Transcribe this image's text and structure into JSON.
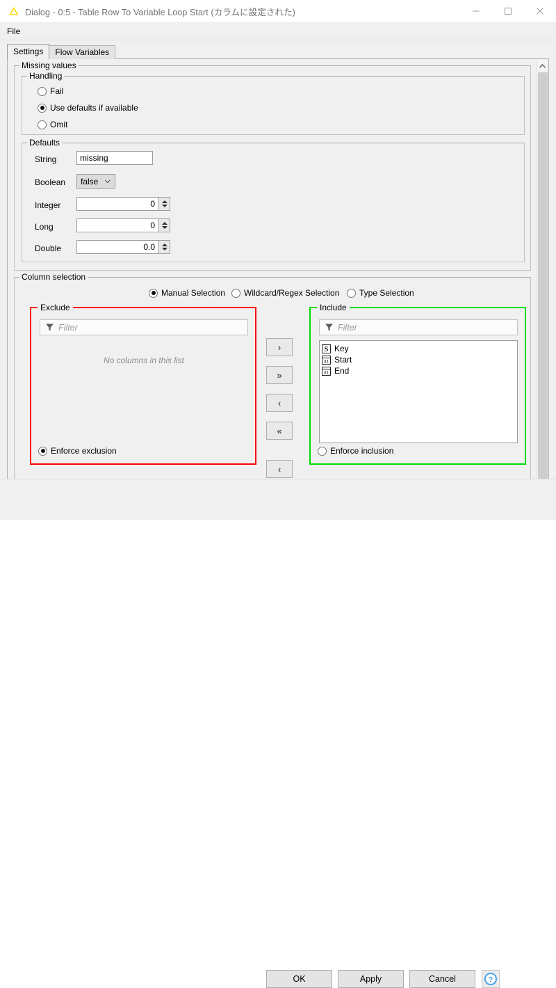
{
  "window": {
    "title": "Dialog - 0:5 - Table Row To Variable Loop Start (カラムに設定された)",
    "icon": "knime-node-icon",
    "minimize_label": "─",
    "maximize_label": "□",
    "close_label": "✕"
  },
  "menubar": {
    "items": [
      {
        "label": "File"
      }
    ]
  },
  "tabs": [
    {
      "label": "Settings",
      "active": true
    },
    {
      "label": "Flow Variables",
      "active": false
    }
  ],
  "missing_values": {
    "group_label": "Missing values",
    "handling": {
      "group_label": "Handling",
      "options": [
        {
          "label": "Fail",
          "selected": false
        },
        {
          "label": "Use defaults if available",
          "selected": true
        },
        {
          "label": "Omit",
          "selected": false
        }
      ]
    },
    "defaults": {
      "group_label": "Defaults",
      "fields": [
        {
          "label": "String",
          "value": "missing",
          "type": "text"
        },
        {
          "label": "Boolean",
          "value": "false",
          "type": "combo"
        },
        {
          "label": "Integer",
          "value": "0",
          "type": "spinner"
        },
        {
          "label": "Long",
          "value": "0",
          "type": "spinner"
        },
        {
          "label": "Double",
          "value": "0.0",
          "type": "spinner"
        }
      ]
    }
  },
  "column_selection": {
    "group_label": "Column selection",
    "modes": [
      {
        "label": "Manual Selection",
        "selected": true
      },
      {
        "label": "Wildcard/Regex Selection",
        "selected": false
      },
      {
        "label": "Type Selection",
        "selected": false
      }
    ],
    "exclude": {
      "label": "Exclude",
      "border_color": "#ff0000",
      "filter_placeholder": "Filter",
      "filter_value": "",
      "empty_message": "No columns in this list",
      "items": [],
      "enforce": {
        "label": "Enforce exclusion",
        "selected": true
      }
    },
    "include": {
      "label": "Include",
      "border_color": "#00dd00",
      "filter_placeholder": "Filter",
      "filter_value": "",
      "items": [
        {
          "name": "Key",
          "type_icon": "string-type-icon",
          "icon_glyph": "S"
        },
        {
          "name": "Start",
          "type_icon": "date-type-icon",
          "icon_glyph": "31"
        },
        {
          "name": "End",
          "type_icon": "date-type-icon",
          "icon_glyph": "31"
        }
      ],
      "enforce": {
        "label": "Enforce inclusion",
        "selected": false
      }
    },
    "transfer_buttons": [
      {
        "label": "›",
        "name": "add-selected-button"
      },
      {
        "label": "»",
        "name": "add-all-button"
      },
      {
        "label": "‹",
        "name": "remove-selected-button"
      },
      {
        "label": "«",
        "name": "remove-all-button"
      }
    ]
  },
  "scrollbar": {
    "up_arrow": "⌃",
    "down_arrow": "⌄"
  },
  "footer": {
    "ok_label": "OK",
    "apply_label": "Apply",
    "cancel_label": "Cancel",
    "help_label": "?"
  }
}
